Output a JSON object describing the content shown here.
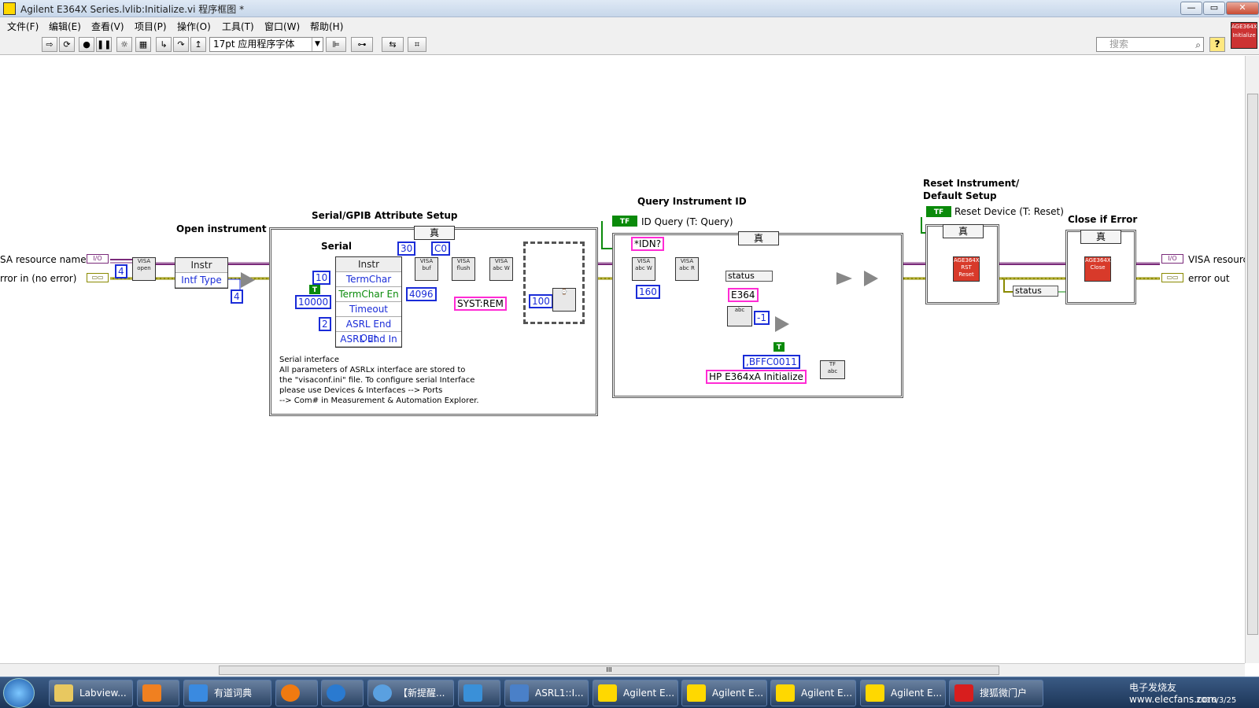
{
  "window": {
    "title": "Agilent E364X Series.lvlib:Initialize.vi 程序框图 *",
    "controls": {
      "minimize": "—",
      "maximize": "▭",
      "close": "✕"
    }
  },
  "menu": [
    "文件(F)",
    "编辑(E)",
    "查看(V)",
    "项目(P)",
    "操作(O)",
    "工具(T)",
    "窗口(W)",
    "帮助(H)"
  ],
  "toolbar": {
    "font": "17pt 应用程序字体",
    "search_placeholder": "搜索",
    "help": "?",
    "vi_icon": "AGE364X Initialize"
  },
  "diagram": {
    "controls_left": {
      "visa_resource": "SA resource name",
      "error_in": "rror in (no error)",
      "visa_tag": "I/O",
      "err_tag": "▭▭"
    },
    "indicators_right": {
      "visa_resource_out": "VISA resourc",
      "error_out": "error out",
      "visa_tag": "I/O",
      "err_tag": "▭▭"
    },
    "open_instrument": {
      "header": "Open instrument",
      "const_4a": "4",
      "const_4b": "4",
      "prop_class": "Instr",
      "prop_item": "Intf Type"
    },
    "serial_setup": {
      "header": "Serial/GPIB Attribute Setup",
      "sub": "Serial",
      "case_sel": "真",
      "prop_class": "Instr",
      "props": [
        "TermChar",
        "TermChar En",
        "Timeout",
        "ASRL End Out",
        "ASRL End In"
      ],
      "consts": {
        "termchar": "10",
        "timeout": "10000",
        "endout": "2",
        "n30": "30",
        "c0": "C0",
        "n4096": "4096",
        "t": "T"
      },
      "syst_rem": "SYST:REM",
      "wait_ms": "100",
      "note": "Serial interface\nAll parameters of ASRLx interface are stored to\nthe \"visaconf.ini\" file. To configure serial Interface\nplease use Devices & Interfaces --> Ports\n--> Com# in Measurement & Automation Explorer."
    },
    "query_id": {
      "header": "Query Instrument ID",
      "control": "ID Query (T: Query)",
      "tf": "TF",
      "case_sel": "真",
      "idn": "*IDN?",
      "n160": "160",
      "status": "status",
      "e364": "E364",
      "neg1": "-1",
      "code": ",BFFC0011",
      "src": "HP E364xA Initialize",
      "t": "T"
    },
    "reset": {
      "header1": "Reset Instrument/",
      "header2": "Default Setup",
      "control": "Reset Device (T: Reset)",
      "tf": "TF",
      "case_sel": "真",
      "vi": "AGE364X RST Reset",
      "status": "status"
    },
    "close_err": {
      "header": "Close if Error",
      "case_sel": "真",
      "vi": "AGE364X Close"
    }
  },
  "scroll": {
    "grip": "III"
  },
  "taskbar": {
    "items": [
      "Labview...",
      "",
      "有道词典",
      "",
      "",
      "【新提醒...",
      "",
      "ASRL1::I...",
      "Agilent E...",
      "Agilent E...",
      "Agilent E...",
      "Agilent E...",
      "搜狐微门户"
    ],
    "date": "2016/3/25",
    "watermark": "电子发烧友 www.elecfans.com"
  },
  "colors": {
    "visa_wire": "#7b2b7b",
    "error_wire": "#8a8a00",
    "num": "#1a2cd8",
    "str": "#ff2bd4",
    "bool": "#0a8a0a"
  }
}
